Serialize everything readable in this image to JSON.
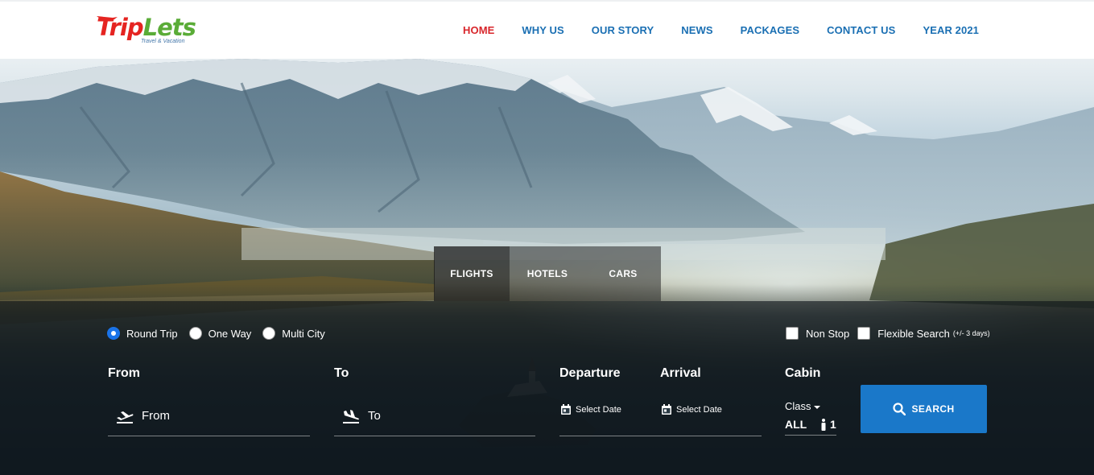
{
  "brand": {
    "name_part1": "Trip",
    "name_part2": "Lets",
    "tagline": "Travel & Vacation"
  },
  "nav": [
    {
      "label": "HOME",
      "active": true
    },
    {
      "label": "WHY US",
      "active": false
    },
    {
      "label": "OUR STORY",
      "active": false
    },
    {
      "label": "NEWS",
      "active": false
    },
    {
      "label": "PACKAGES",
      "active": false
    },
    {
      "label": "CONTACT US",
      "active": false
    },
    {
      "label": "YEAR 2021",
      "active": false
    }
  ],
  "tabs": [
    {
      "label": "FLIGHTS",
      "active": true
    },
    {
      "label": "HOTELS",
      "active": false
    },
    {
      "label": "CARS",
      "active": false
    }
  ],
  "trip_type": {
    "options": [
      "Round Trip",
      "One Way",
      "Multi City"
    ],
    "selected": "Round Trip"
  },
  "filters": {
    "non_stop": {
      "label": "Non Stop",
      "checked": false
    },
    "flexible": {
      "label": "Flexible Search",
      "note": "(+/- 3 days)",
      "checked": false
    }
  },
  "labels": {
    "from": "From",
    "to": "To",
    "departure": "Departure",
    "arrival": "Arrival",
    "cabin": "Cabin"
  },
  "fields": {
    "from_placeholder": "From",
    "to_placeholder": "To",
    "departure_placeholder": "Select Date",
    "arrival_placeholder": "Select Date"
  },
  "cabin": {
    "class_label": "Class",
    "value": "ALL",
    "passengers": "1"
  },
  "search_button": "SEARCH",
  "colors": {
    "brand_red": "#e52421",
    "brand_green": "#5aac37",
    "nav_blue": "#1a6fb3",
    "nav_active": "#d8262b",
    "button_blue": "#1a78c9"
  }
}
